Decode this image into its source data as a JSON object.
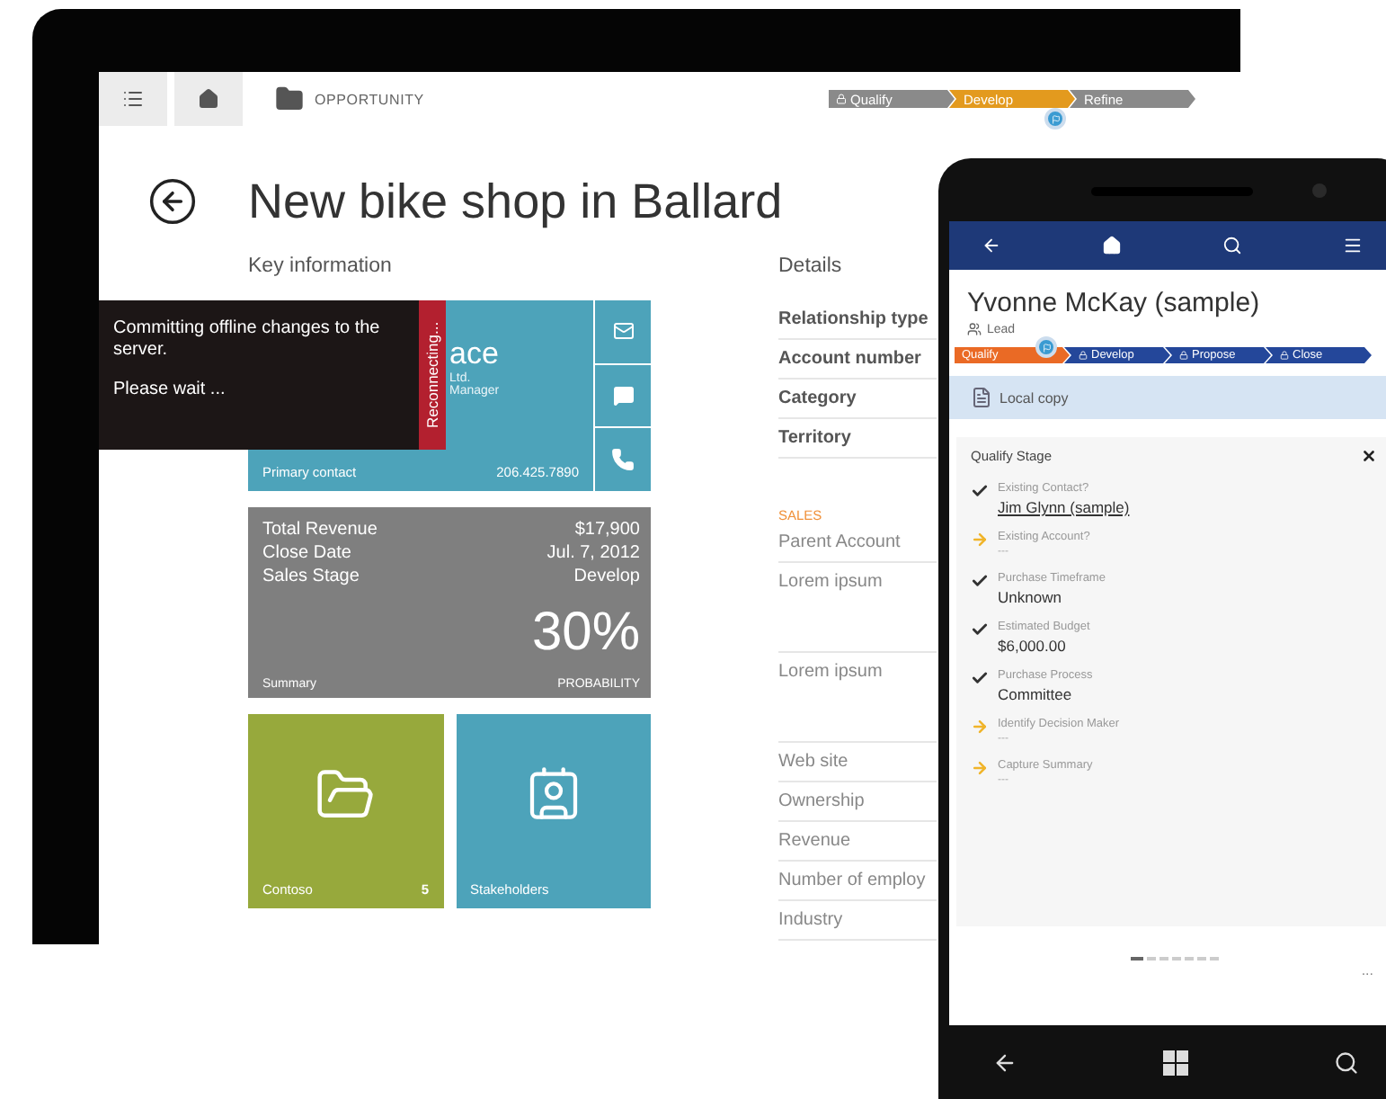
{
  "tablet": {
    "nav": {
      "entity": "OPPORTUNITY"
    },
    "stages": [
      {
        "label": "Qualify",
        "selected": false,
        "locked": true
      },
      {
        "label": "Develop",
        "selected": true,
        "locked": false
      },
      {
        "label": "Refine",
        "selected": false,
        "locked": false
      }
    ],
    "title": "New bike shop in Ballard",
    "key_information": {
      "heading": "Key information",
      "contact_tile": {
        "name": "ace",
        "company": "Ltd.",
        "role": "Manager",
        "label": "Primary contact",
        "phone": "206.425.7890"
      },
      "summary_tile": {
        "rows": [
          {
            "label": "Total Revenue",
            "value": "$17,900"
          },
          {
            "label": "Close Date",
            "value": "Jul. 7, 2012"
          },
          {
            "label": "Sales Stage",
            "value": "Develop"
          }
        ],
        "percent": "30%",
        "percent_label": "PROBABILITY",
        "label": "Summary"
      },
      "tiles": [
        {
          "kind": "folder",
          "label": "Contoso",
          "count": "5",
          "color": "#97a93c"
        },
        {
          "kind": "contact",
          "label": "Stakeholders",
          "color": "#4da3ba"
        }
      ]
    },
    "details": {
      "heading": "Details",
      "rows": [
        {
          "kind": "header",
          "label": "Relationship type"
        },
        {
          "kind": "header",
          "label": "Account number"
        },
        {
          "kind": "header",
          "label": "Category"
        },
        {
          "kind": "header",
          "label": "Territory"
        },
        {
          "kind": "section",
          "label": "SALES"
        },
        {
          "kind": "field",
          "label": "Parent Account"
        },
        {
          "kind": "memo",
          "label": "Lorem ipsum"
        },
        {
          "kind": "memo",
          "label": "Lorem ipsum"
        },
        {
          "kind": "field",
          "label": "Web site"
        },
        {
          "kind": "field",
          "label": "Ownership"
        },
        {
          "kind": "field",
          "label": "Revenue"
        },
        {
          "kind": "field",
          "label": "Number of employ"
        },
        {
          "kind": "field",
          "label": "Industry"
        }
      ]
    },
    "toast": {
      "message": "Committing offline changes to the server.",
      "hint": "Please wait ...",
      "status": "Reconnecting..."
    }
  },
  "phone": {
    "title": "Yvonne McKay (sample)",
    "entity": "Lead",
    "stages": [
      {
        "label": "Qualify",
        "selected": true
      },
      {
        "label": "Develop",
        "selected": false
      },
      {
        "label": "Propose",
        "selected": false
      },
      {
        "label": "Close",
        "selected": false
      }
    ],
    "banner": "Local copy",
    "stage_panel": {
      "heading": "Qualify Stage",
      "steps": [
        {
          "kind": "done",
          "label": "Existing Contact?",
          "value": "Jim Glynn (sample)",
          "link": true
        },
        {
          "kind": "pending",
          "label": "Existing Account?",
          "value": "---",
          "link": false
        },
        {
          "kind": "done",
          "label": "Purchase Timeframe",
          "value": "Unknown",
          "link": false
        },
        {
          "kind": "done",
          "label": "Estimated Budget",
          "value": "$6,000.00",
          "link": false
        },
        {
          "kind": "done",
          "label": "Purchase Process",
          "value": "Committee",
          "link": false
        },
        {
          "kind": "pending",
          "label": "Identify Decision Maker",
          "value": "---",
          "link": false
        },
        {
          "kind": "pending",
          "label": "Capture Summary",
          "value": "---",
          "link": false
        }
      ]
    },
    "pager": [
      {
        "selected": true
      },
      {
        "selected": false
      },
      {
        "selected": false
      },
      {
        "selected": false
      },
      {
        "selected": false
      },
      {
        "selected": false
      },
      {
        "selected": false
      }
    ],
    "more": "..."
  }
}
